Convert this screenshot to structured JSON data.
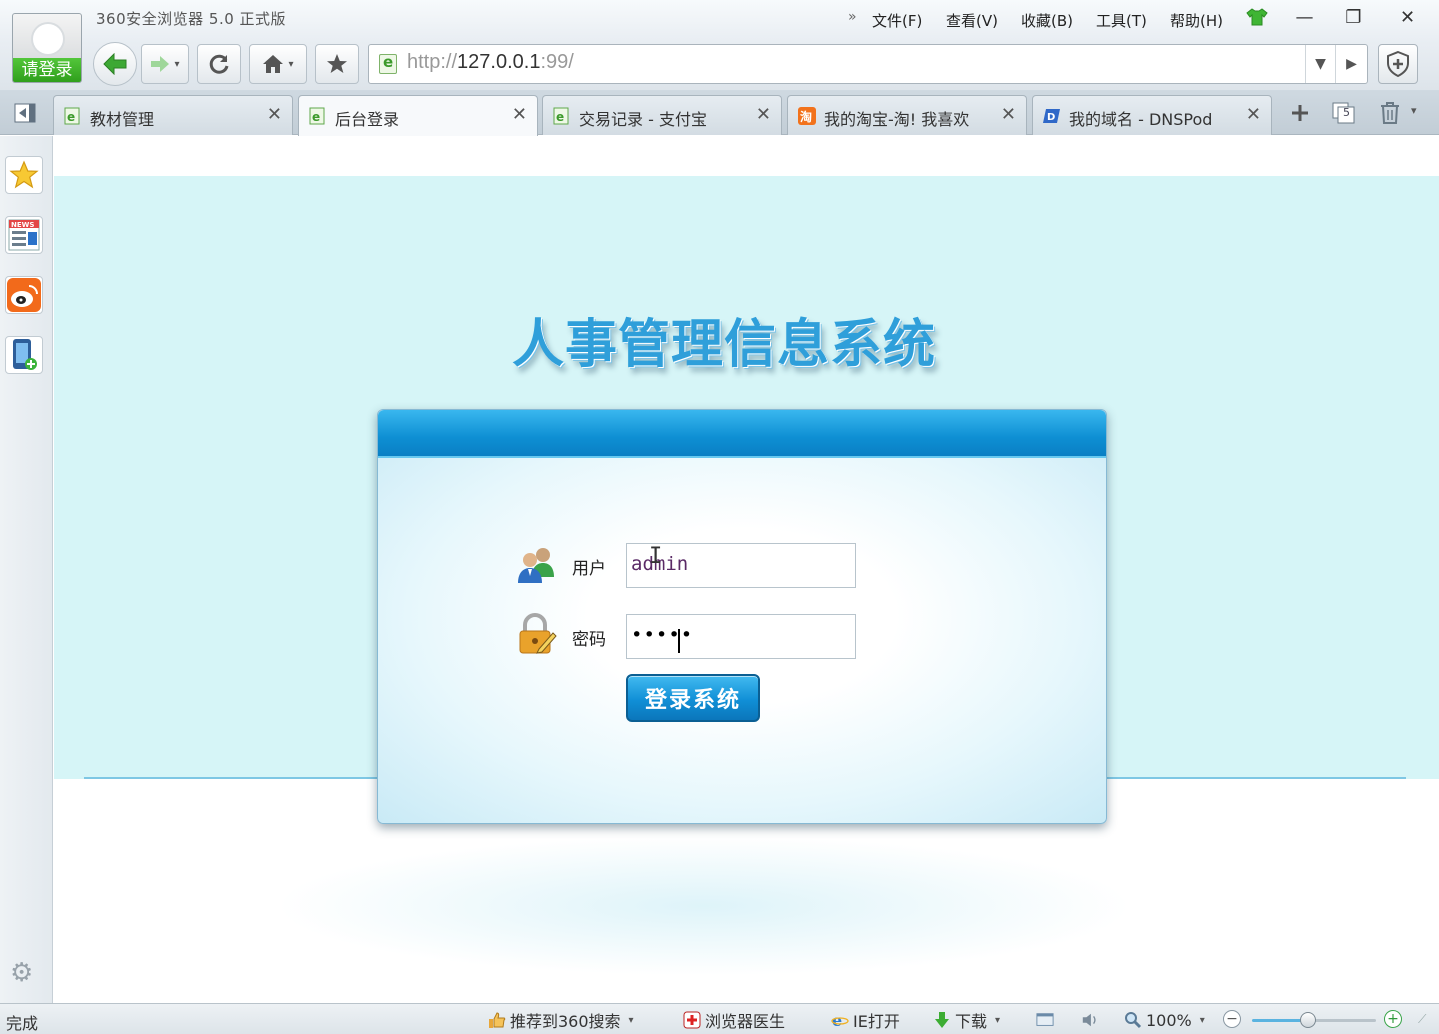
{
  "app": {
    "title": "360安全浏览器 5.0 正式版",
    "login_label": "请登录"
  },
  "menu": {
    "more": "»",
    "items": [
      {
        "label": "文件(F)"
      },
      {
        "label": "查看(V)"
      },
      {
        "label": "收藏(B)"
      },
      {
        "label": "工具(T)"
      },
      {
        "label": "帮助(H)"
      }
    ]
  },
  "window_controls": {
    "minimize": "—",
    "restore": "❐",
    "close": "✕"
  },
  "address": {
    "scheme": "http://",
    "host": "127.0.0.1",
    "port": ":99/"
  },
  "tabs": [
    {
      "label": "教材管理",
      "icon": "ie-page-icon",
      "active": false
    },
    {
      "label": "后台登录",
      "icon": "ie-page-icon",
      "active": true
    },
    {
      "label": "交易记录 - 支付宝",
      "icon": "ie-page-icon",
      "active": false
    },
    {
      "label": "我的淘宝-淘! 我喜欢",
      "icon": "taobao-icon",
      "active": false
    },
    {
      "label": "我的域名 - DNSPod",
      "icon": "dnspod-icon",
      "active": false
    }
  ],
  "tab_controls": {
    "closed_tabs_count": "5"
  },
  "sidebar": {
    "items": [
      "favorites-star-icon",
      "news-icon",
      "weibo-icon",
      "mobile-icon"
    ]
  },
  "page": {
    "system_title": "人事管理信息系统",
    "user_label": "用户",
    "username_value": "admin",
    "password_label": "密码",
    "password_value": "•••••",
    "login_button": "登录系统"
  },
  "status": {
    "text": "完成",
    "recommend_360": "推荐到360搜索",
    "browser_doctor": "浏览器医生",
    "ie_open": "IE打开",
    "download": "下载",
    "zoom": "100%",
    "zoom_level_fraction": 0.45
  },
  "colors": {
    "accent_blue": "#1a9ad9",
    "page_band": "#d6f5f7",
    "login_green": "#39b52a"
  }
}
